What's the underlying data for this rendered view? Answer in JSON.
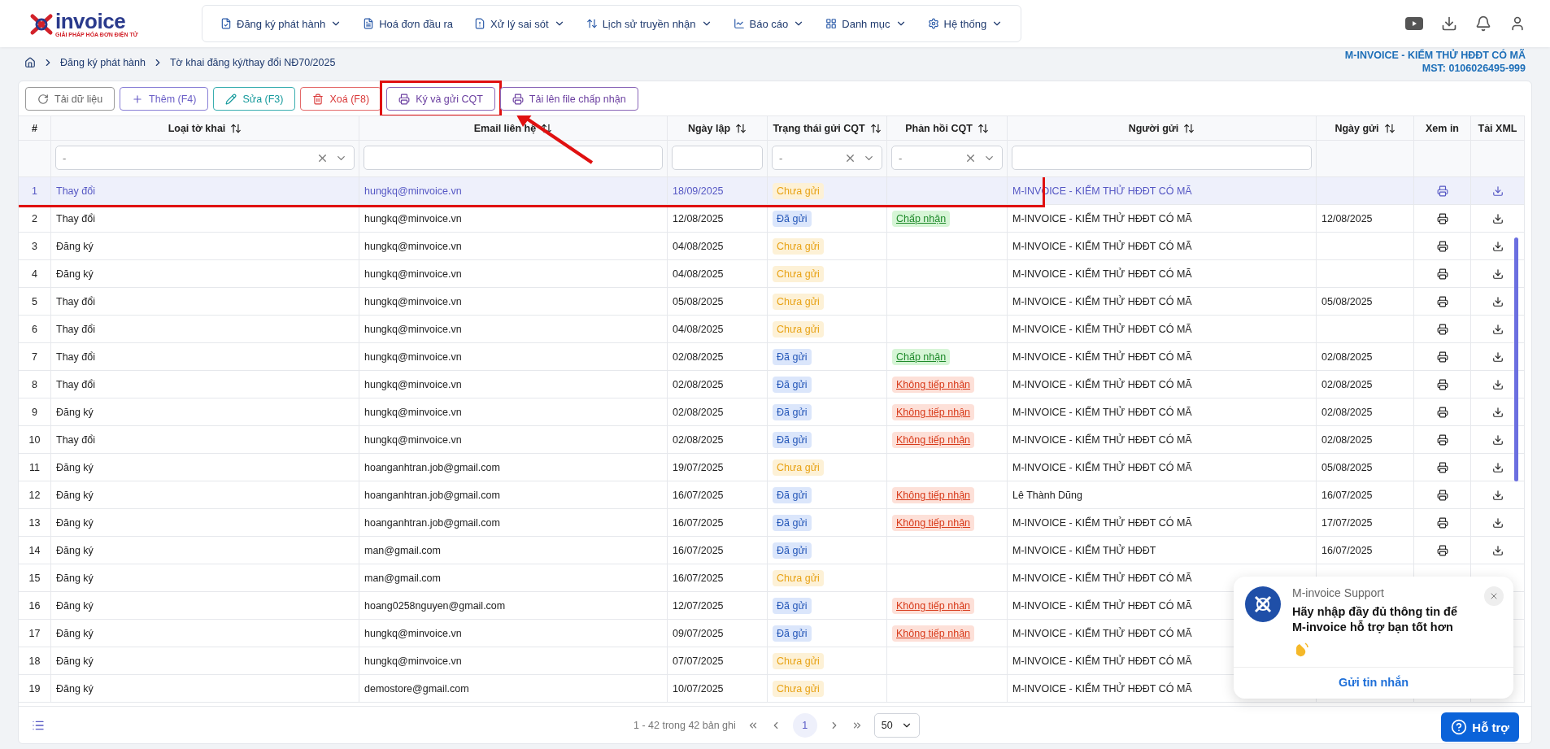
{
  "logo": {
    "name": "invoice",
    "tagline": "GIẢI PHÁP HÓA ĐƠN ĐIỆN TỬ"
  },
  "nav": [
    {
      "label": "Đăng ký phát hành",
      "kind": "register",
      "dropdown": true
    },
    {
      "label": "Hoá đơn đầu ra",
      "kind": "invoice",
      "dropdown": false
    },
    {
      "label": "Xử lý sai sót",
      "kind": "error",
      "dropdown": true
    },
    {
      "label": "Lịch sử truyền nhận",
      "kind": "transfer",
      "dropdown": true
    },
    {
      "label": "Báo cáo",
      "kind": "report",
      "dropdown": true
    },
    {
      "label": "Danh mục",
      "kind": "category",
      "dropdown": true
    },
    {
      "label": "Hệ thống",
      "kind": "system",
      "dropdown": true
    }
  ],
  "breadcrumb": [
    "Đăng ký phát hành",
    "Tờ khai đăng ký/thay đổi NĐ70/2025"
  ],
  "company": {
    "name": "M-INVOICE - KIỂM THỬ HĐĐT CÓ MÃ",
    "tax_id": "MST: 0106026495-999"
  },
  "toolbar": [
    {
      "label": "Tải dữ liệu",
      "kind": "reload",
      "highlighted": false
    },
    {
      "label": "Thêm (F4)",
      "kind": "add",
      "highlighted": false
    },
    {
      "label": "Sửa (F3)",
      "kind": "edit",
      "highlighted": false
    },
    {
      "label": "Xoá (F8)",
      "kind": "delete",
      "highlighted": false
    },
    {
      "label": "Ký và gửi CQT",
      "kind": "sign",
      "highlighted": true
    },
    {
      "label": "Tải lên file chấp nhận",
      "kind": "upload",
      "highlighted": false
    }
  ],
  "annotation_arrow": true,
  "table": {
    "columns": [
      {
        "label": "#",
        "sortable": false
      },
      {
        "label": "Loại tờ khai",
        "sortable": true,
        "filter": {
          "kind": "select",
          "value": "-"
        }
      },
      {
        "label": "Email liên hệ",
        "sortable": true,
        "filter": {
          "kind": "text"
        }
      },
      {
        "label": "Ngày lập",
        "sortable": true,
        "filter": {
          "kind": "text"
        }
      },
      {
        "label": "Trạng thái gửi CQT",
        "sortable": true,
        "filter": {
          "kind": "select",
          "value": "-"
        }
      },
      {
        "label": "Phản hồi CQT",
        "sortable": true,
        "filter": {
          "kind": "select",
          "value": "-"
        }
      },
      {
        "label": "Người gửi",
        "sortable": true,
        "filter": {
          "kind": "text"
        }
      },
      {
        "label": "Ngày gửi",
        "sortable": true
      },
      {
        "label": "Xem in",
        "sortable": false
      },
      {
        "label": "Tải XML",
        "sortable": false
      }
    ],
    "rows": [
      {
        "no": "1",
        "type": "Thay đổi",
        "email": "hungkq@minvoice.vn",
        "created": "18/09/2025",
        "status": {
          "label": "Chưa gửi",
          "kind": "pending"
        },
        "sender": "M-INVOICE - KIỂM THỬ HĐĐT CÓ MÃ",
        "actions": true,
        "selected": true,
        "highlighted": true
      },
      {
        "no": "2",
        "type": "Thay đổi",
        "email": "hungkq@minvoice.vn",
        "created": "12/08/2025",
        "status": {
          "label": "Đã gửi",
          "kind": "sent"
        },
        "response": {
          "label": "Chấp nhận",
          "kind": "accepted"
        },
        "sender": "M-INVOICE - KIỂM THỬ HĐĐT CÓ MÃ",
        "sent_date": "12/08/2025",
        "actions": true,
        "selected": false,
        "highlighted": false
      },
      {
        "no": "3",
        "type": "Đăng ký",
        "email": "hungkq@minvoice.vn",
        "created": "04/08/2025",
        "status": {
          "label": "Chưa gửi",
          "kind": "pending"
        },
        "sender": "M-INVOICE - KIỂM THỬ HĐĐT CÓ MÃ",
        "actions": true,
        "selected": false,
        "highlighted": false
      },
      {
        "no": "4",
        "type": "Đăng ký",
        "email": "hungkq@minvoice.vn",
        "created": "04/08/2025",
        "status": {
          "label": "Chưa gửi",
          "kind": "pending"
        },
        "sender": "M-INVOICE - KIỂM THỬ HĐĐT CÓ MÃ",
        "actions": true,
        "selected": false,
        "highlighted": false
      },
      {
        "no": "5",
        "type": "Thay đổi",
        "email": "hungkq@minvoice.vn",
        "created": "05/08/2025",
        "status": {
          "label": "Chưa gửi",
          "kind": "pending"
        },
        "sender": "M-INVOICE - KIỂM THỬ HĐĐT CÓ MÃ",
        "sent_date": "05/08/2025",
        "actions": true,
        "selected": false,
        "highlighted": false
      },
      {
        "no": "6",
        "type": "Thay đổi",
        "email": "hungkq@minvoice.vn",
        "created": "04/08/2025",
        "status": {
          "label": "Chưa gửi",
          "kind": "pending"
        },
        "sender": "M-INVOICE - KIỂM THỬ HĐĐT CÓ MÃ",
        "actions": true,
        "selected": false,
        "highlighted": false
      },
      {
        "no": "7",
        "type": "Thay đổi",
        "email": "hungkq@minvoice.vn",
        "created": "02/08/2025",
        "status": {
          "label": "Đã gửi",
          "kind": "sent"
        },
        "response": {
          "label": "Chấp nhận",
          "kind": "accepted"
        },
        "sender": "M-INVOICE - KIỂM THỬ HĐĐT CÓ MÃ",
        "sent_date": "02/08/2025",
        "actions": true,
        "selected": false,
        "highlighted": false
      },
      {
        "no": "8",
        "type": "Thay đổi",
        "email": "hungkq@minvoice.vn",
        "created": "02/08/2025",
        "status": {
          "label": "Đã gửi",
          "kind": "sent"
        },
        "response": {
          "label": "Không tiếp nhận",
          "kind": "rejected"
        },
        "sender": "M-INVOICE - KIỂM THỬ HĐĐT CÓ MÃ",
        "sent_date": "02/08/2025",
        "actions": true,
        "selected": false,
        "highlighted": false
      },
      {
        "no": "9",
        "type": "Đăng ký",
        "email": "hungkq@minvoice.vn",
        "created": "02/08/2025",
        "status": {
          "label": "Đã gửi",
          "kind": "sent"
        },
        "response": {
          "label": "Không tiếp nhận",
          "kind": "rejected"
        },
        "sender": "M-INVOICE - KIỂM THỬ HĐĐT CÓ MÃ",
        "sent_date": "02/08/2025",
        "actions": true,
        "selected": false,
        "highlighted": false
      },
      {
        "no": "10",
        "type": "Thay đổi",
        "email": "hungkq@minvoice.vn",
        "created": "02/08/2025",
        "status": {
          "label": "Đã gửi",
          "kind": "sent"
        },
        "response": {
          "label": "Không tiếp nhận",
          "kind": "rejected"
        },
        "sender": "M-INVOICE - KIỂM THỬ HĐĐT CÓ MÃ",
        "sent_date": "02/08/2025",
        "actions": true,
        "selected": false,
        "highlighted": false
      },
      {
        "no": "11",
        "type": "Đăng ký",
        "email": "hoanganhtran.job@gmail.com",
        "created": "19/07/2025",
        "status": {
          "label": "Chưa gửi",
          "kind": "pending"
        },
        "sender": "M-INVOICE - KIỂM THỬ HĐĐT CÓ MÃ",
        "sent_date": "05/08/2025",
        "actions": true,
        "selected": false,
        "highlighted": false
      },
      {
        "no": "12",
        "type": "Đăng ký",
        "email": "hoanganhtran.job@gmail.com",
        "created": "16/07/2025",
        "status": {
          "label": "Đã gửi",
          "kind": "sent"
        },
        "response": {
          "label": "Không tiếp nhận",
          "kind": "rejected"
        },
        "sender": "Lê Thành Dũng",
        "sent_date": "16/07/2025",
        "actions": true,
        "selected": false,
        "highlighted": false
      },
      {
        "no": "13",
        "type": "Đăng ký",
        "email": "hoanganhtran.job@gmail.com",
        "created": "16/07/2025",
        "status": {
          "label": "Đã gửi",
          "kind": "sent"
        },
        "response": {
          "label": "Không tiếp nhận",
          "kind": "rejected"
        },
        "sender": "M-INVOICE - KIỂM THỬ HĐĐT CÓ MÃ",
        "sent_date": "17/07/2025",
        "actions": true,
        "selected": false,
        "highlighted": false
      },
      {
        "no": "14",
        "type": "Đăng ký",
        "email": "man@gmail.com",
        "created": "16/07/2025",
        "status": {
          "label": "Đã gửi",
          "kind": "sent"
        },
        "sender": "M-INVOICE - KIỂM THỬ HĐĐT",
        "sent_date": "16/07/2025",
        "actions": true,
        "selected": false,
        "highlighted": false
      },
      {
        "no": "15",
        "type": "Đăng ký",
        "email": "man@gmail.com",
        "created": "16/07/2025",
        "status": {
          "label": "Chưa gửi",
          "kind": "pending"
        },
        "sender": "M-INVOICE - KIỂM THỬ HĐĐT CÓ MÃ",
        "actions": false,
        "selected": false,
        "highlighted": false
      },
      {
        "no": "16",
        "type": "Đăng ký",
        "email": "hoang0258nguyen@gmail.com",
        "created": "12/07/2025",
        "status": {
          "label": "Đã gửi",
          "kind": "sent"
        },
        "response": {
          "label": "Không tiếp nhận",
          "kind": "rejected"
        },
        "sender": "M-INVOICE - KIỂM THỬ HĐĐT CÓ MÃ",
        "actions": false,
        "selected": false,
        "highlighted": false
      },
      {
        "no": "17",
        "type": "Đăng ký",
        "email": "hungkq@minvoice.vn",
        "created": "09/07/2025",
        "status": {
          "label": "Đã gửi",
          "kind": "sent"
        },
        "response": {
          "label": "Không tiếp nhận",
          "kind": "rejected"
        },
        "sender": "M-INVOICE - KIỂM THỬ HĐĐT CÓ MÃ",
        "actions": false,
        "selected": false,
        "highlighted": false
      },
      {
        "no": "18",
        "type": "Đăng ký",
        "email": "hungkq@minvoice.vn",
        "created": "07/07/2025",
        "status": {
          "label": "Chưa gửi",
          "kind": "pending"
        },
        "sender": "M-INVOICE - KIỂM THỬ HĐĐT CÓ MÃ",
        "actions": false,
        "selected": false,
        "highlighted": false
      },
      {
        "no": "19",
        "type": "Đăng ký",
        "email": "demostore@gmail.com",
        "created": "10/07/2025",
        "status": {
          "label": "Chưa gửi",
          "kind": "pending"
        },
        "sender": "M-INVOICE - KIỂM THỬ HĐĐT CÓ MÃ",
        "actions": false,
        "selected": false,
        "highlighted": false
      }
    ]
  },
  "pagination": {
    "summary": "1 - 42 trong 42 bản ghi",
    "pages": [
      {
        "label": "1",
        "selected": true
      }
    ],
    "page_size": "50"
  },
  "chat": {
    "title": "M-invoice Support",
    "message": "Hãy nhập đầy đủ thông tin để M-invoice hỗ trợ bạn tốt hơn",
    "wave": true,
    "action": "Gửi tin nhắn"
  },
  "help_button": "Hỗ trợ"
}
